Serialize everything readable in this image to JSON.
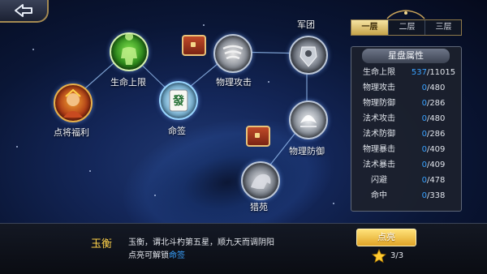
{
  "tabs": [
    "一层",
    "二层",
    "三层"
  ],
  "selected_tab": "一层",
  "nodes": {
    "hp_limit": "生命上限",
    "fuli": "点将福利",
    "mingqian": "命签",
    "physical_attack": "物理攻击",
    "juntuan": "军团",
    "physical_defense": "物理防御",
    "liewan": "猎苑"
  },
  "mingqian_glyph": "發",
  "panel": {
    "title": "星盘属性",
    "stats": [
      {
        "label": "生命上限",
        "current": "537",
        "max": "/11015"
      },
      {
        "label": "物理攻击",
        "current": "0",
        "max": "/480"
      },
      {
        "label": "物理防御",
        "current": "0",
        "max": "/286"
      },
      {
        "label": "法术攻击",
        "current": "0",
        "max": "/480"
      },
      {
        "label": "法术防御",
        "current": "0",
        "max": "/286"
      },
      {
        "label": "物理暴击",
        "current": "0",
        "max": "/409"
      },
      {
        "label": "法术暴击",
        "current": "0",
        "max": "/409"
      },
      {
        "label": "闪避",
        "current": "0",
        "max": "/478"
      },
      {
        "label": "命中",
        "current": "0",
        "max": "/338"
      }
    ]
  },
  "bottom": {
    "star_name": "玉衡",
    "description": "玉衡，谓北斗杓第五星，顺九天而调阴阳",
    "unlock_prefix": "点亮可解锁",
    "unlock_target": "命签",
    "light_button": "点亮",
    "star_count": "3/3"
  },
  "colors": {
    "accent_gold": "#ffd24a",
    "value_blue": "#3aa2ff"
  },
  "icons": {
    "back": "back-arrow-icon",
    "star": "star-icon",
    "chest": "treasure-chest-icon"
  }
}
